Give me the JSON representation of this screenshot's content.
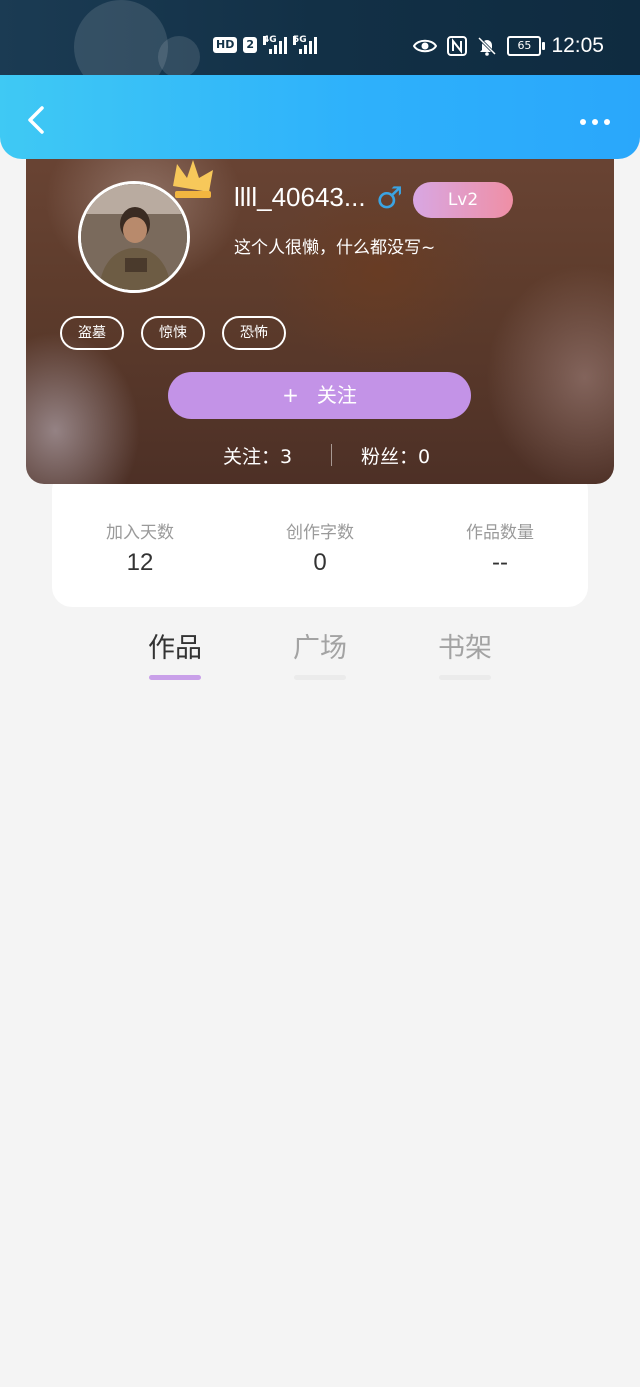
{
  "status_bar": {
    "badges": [
      "HD",
      "2"
    ],
    "network_1": "4G",
    "network_2": "5G",
    "battery": "65",
    "time": "12:05"
  },
  "header": {
    "back_icon": "chevron-left-icon",
    "more_icon": "more-dots-icon"
  },
  "profile": {
    "username": "llll_40643...",
    "gender_symbol": "♂",
    "gender_color": "#3ba4e3",
    "level": "Lv2",
    "bio": "这个人很懒，什么都没写~",
    "tags": [
      "盗墓",
      "惊悚",
      "恐怖"
    ],
    "follow_button": {
      "icon": "+",
      "label": "关注"
    },
    "following": "关注：3",
    "fans": "粉丝：0"
  },
  "stats": [
    {
      "label": "加入天数",
      "value": "12"
    },
    {
      "label": "创作字数",
      "value": "0"
    },
    {
      "label": "作品数量",
      "value": "--"
    }
  ],
  "tabs": [
    {
      "label": "作品",
      "active": true
    },
    {
      "label": "广场",
      "active": false
    },
    {
      "label": "书架",
      "active": false
    }
  ],
  "colors": {
    "header_accent": "#2eb1fb",
    "follow_button": "#c393e7",
    "tab_indicator": "#c9a0e9"
  }
}
